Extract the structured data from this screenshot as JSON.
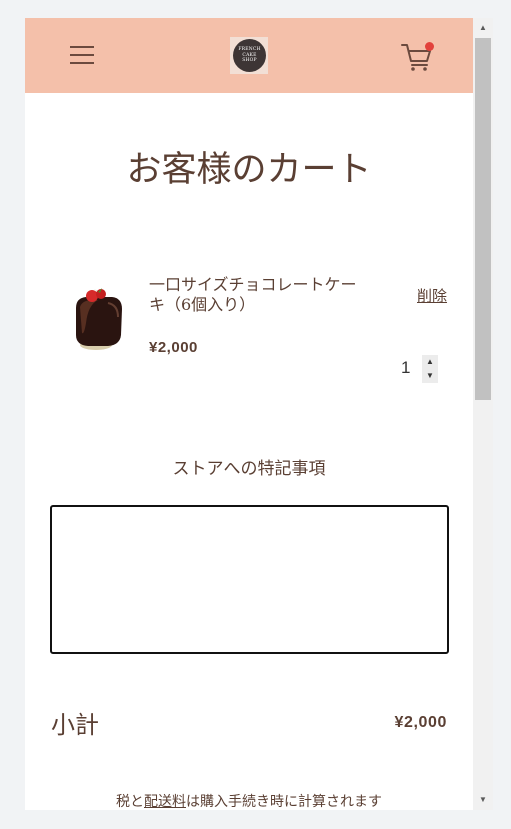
{
  "header": {
    "logo_lines": [
      "FRENCH",
      "CAKE",
      "SHOP"
    ],
    "cart_badge_color": "#e2423c",
    "background": "#f4c0aa"
  },
  "page": {
    "title": "お客様のカート"
  },
  "cart": {
    "items": [
      {
        "name": "一口サイズチョコレートケーキ（6個入り）",
        "price": "¥2,000",
        "quantity": "1",
        "remove_label": "削除"
      }
    ]
  },
  "notes": {
    "label": "ストアへの特記事項",
    "value": ""
  },
  "summary": {
    "subtotal_label": "小計",
    "subtotal_value": "¥2,000",
    "tax_note_before": "税と",
    "tax_note_link": "配送料",
    "tax_note_after": "は購入手続き時に計算されます"
  },
  "icons": {
    "menu": "hamburger-menu-icon",
    "cart": "shopping-cart-icon"
  }
}
